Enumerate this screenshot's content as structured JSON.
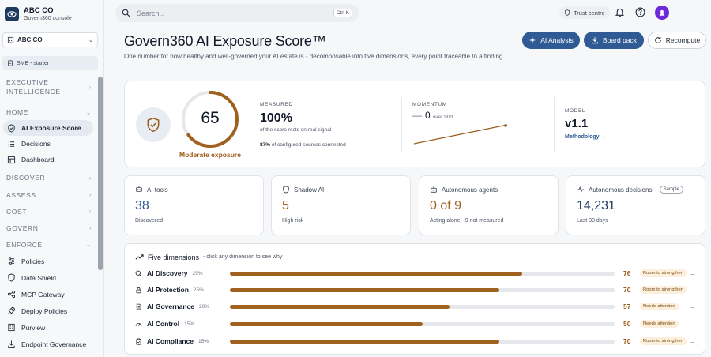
{
  "app": {
    "brand_name": "ABC CO",
    "brand_sub": "Govern360 console",
    "org_select": "ABC CO",
    "plan": "SMB - starter"
  },
  "sidebar": {
    "sections": [
      {
        "label": "EXECUTIVE",
        "label2": "INTELLIGENCE"
      },
      {
        "label": "HOME"
      },
      {
        "label": "DISCOVER"
      },
      {
        "label": "ASSESS"
      },
      {
        "label": "COST"
      },
      {
        "label": "GOVERN"
      },
      {
        "label": "ENFORCE"
      }
    ],
    "home_items": [
      {
        "label": "AI Exposure Score",
        "icon": "shield-check-icon",
        "active": true
      },
      {
        "label": "Decisions",
        "icon": "list-icon"
      },
      {
        "label": "Dashboard",
        "icon": "dashboard-icon"
      }
    ],
    "enforce_items": [
      {
        "label": "Policies",
        "icon": "sliders-icon"
      },
      {
        "label": "Data Shield",
        "icon": "shield-icon"
      },
      {
        "label": "MCP Gateway",
        "icon": "gateway-icon"
      },
      {
        "label": "Deploy Policies",
        "icon": "rocket-icon"
      },
      {
        "label": "Purview",
        "icon": "building-icon"
      },
      {
        "label": "Endpoint Governance",
        "icon": "download-icon"
      }
    ]
  },
  "topbar": {
    "search_placeholder": "Search...",
    "search_shortcut": "Ctrl K",
    "trust_centre": "Trust centre"
  },
  "header": {
    "title": "Govern360 AI Exposure Score™",
    "description": "One number for how healthy and well-governed your AI estate is - decomposable into five dimensions, every point traceable to a finding.",
    "buttons": {
      "ai_analysis": "AI Analysis",
      "board_pack": "Board pack",
      "recompute": "Recompute"
    }
  },
  "score": {
    "value": "65",
    "value_fraction": 0.65,
    "label": "Moderate exposure",
    "measured_kicker": "MEASURED",
    "measured_value": "100%",
    "measured_caption": "of the score rests on real signal",
    "sources_pct": "87%",
    "sources_text": "of configured sources connected",
    "momentum_kicker": "MOMENTUM",
    "momentum_dash": "—",
    "momentum_value": "0",
    "momentum_period": "over 90d",
    "model_kicker": "MODEL",
    "model_value": "v1.1",
    "methodology_link": "Methodology →"
  },
  "stats": [
    {
      "title": "AI tools",
      "value": "38",
      "caption": "Discovered",
      "value_color": "#2f5a93",
      "icon": "tool-icon"
    },
    {
      "title": "Shadow AI",
      "value": "5",
      "caption": "High risk",
      "value_color": "#a0611f",
      "icon": "shield-icon"
    },
    {
      "title": "Autonomous agents",
      "value": "0 of 9",
      "caption": "Acting alone - 9 not measured",
      "value_color": "#a0611f",
      "icon": "agent-icon"
    },
    {
      "title": "Autonomous decisions",
      "value": "14,231",
      "caption": "Last 30 days",
      "badge": "Sample",
      "value_color": "#1e3a5f",
      "icon": "pulse-icon"
    }
  ],
  "dimensions": {
    "title": "Five dimensions",
    "hint": "- click any dimension to see why",
    "rows": [
      {
        "name": "AI Discovery",
        "weight": "25%",
        "score": "76",
        "fraction": 0.76,
        "status": "Room to strengthen",
        "icon": "search-icon"
      },
      {
        "name": "AI Protection",
        "weight": "25%",
        "score": "70",
        "fraction": 0.7,
        "status": "Room to strengthen",
        "icon": "lock-icon"
      },
      {
        "name": "AI Governance",
        "weight": "20%",
        "score": "57",
        "fraction": 0.57,
        "status": "Needs attention",
        "icon": "document-icon"
      },
      {
        "name": "AI Control",
        "weight": "15%",
        "score": "50",
        "fraction": 0.5,
        "status": "Needs attention",
        "icon": "gauge-icon"
      },
      {
        "name": "AI Compliance",
        "weight": "15%",
        "score": "70",
        "fraction": 0.7,
        "status": "Room to strengthen",
        "icon": "clipboard-icon"
      }
    ]
  },
  "colors": {
    "accent": "#2f5a93",
    "warning": "#a0611f",
    "badge_bg": "#fcefdc"
  }
}
